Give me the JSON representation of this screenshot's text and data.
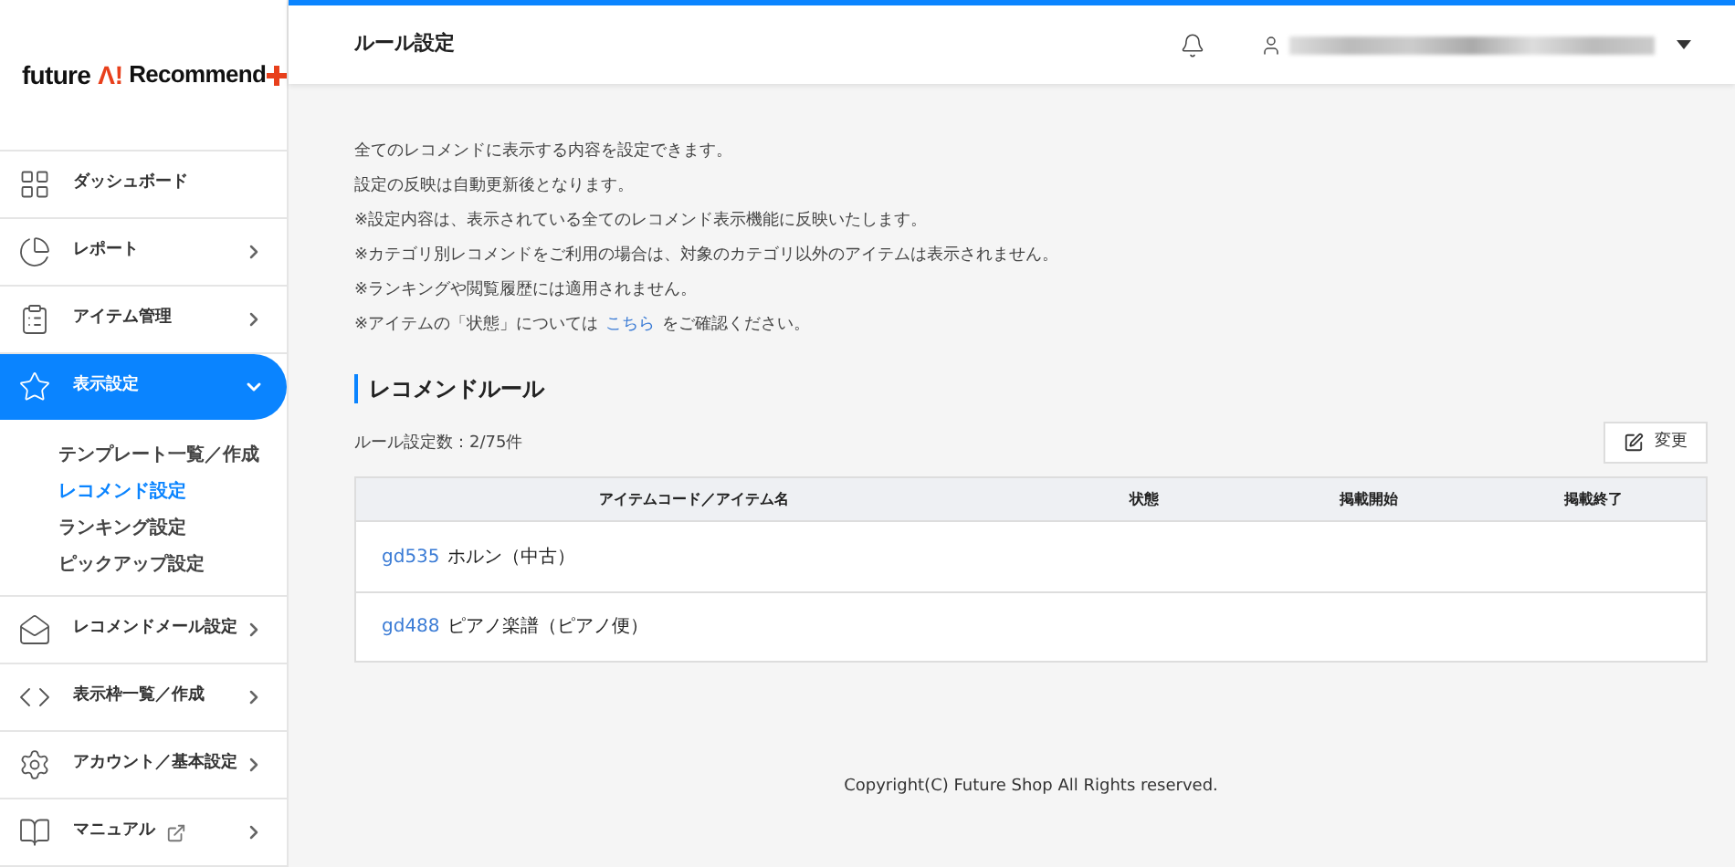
{
  "logo": {
    "part_1": "future",
    "part_2": "Λ!",
    "part_3": "Recommend"
  },
  "sidebar": {
    "items": [
      {
        "label": "ダッシュボード",
        "selected": false
      },
      {
        "label": "レポート",
        "selected": false,
        "expanded": false
      },
      {
        "label": "アイテム管理",
        "selected": false,
        "expanded": false
      },
      {
        "label": "表示設定",
        "selected": true,
        "expanded": true,
        "children": [
          {
            "label": "テンプレート一覧／作成",
            "selected": false
          },
          {
            "label": "レコメンド設定",
            "selected": true
          },
          {
            "label": "ランキング設定",
            "selected": false
          },
          {
            "label": "ピックアップ設定",
            "selected": false
          }
        ]
      },
      {
        "label": "レコメンドメール設定",
        "selected": false,
        "expanded": false
      },
      {
        "label": "表示枠一覧／作成",
        "selected": false,
        "expanded": false
      },
      {
        "label": "アカウント／基本設定",
        "selected": false,
        "expanded": false
      },
      {
        "label": "マニュアル",
        "selected": false,
        "expanded": false,
        "external": true
      }
    ]
  },
  "header": {
    "title": "ルール設定"
  },
  "notes": [
    "全てのレコメンドに表示する内容を設定できます。",
    "設定の反映は自動更新後となります。",
    "※設定内容は、表示されている全てのレコメンド表示機能に反映いたします。",
    "※カテゴリ別レコメンドをご利用の場合は、対象のカテゴリ以外のアイテムは表示されません。",
    "※ランキングや閲覧履歴には適用されません。"
  ],
  "status_note": {
    "before": "※アイテムの「状態」については",
    "link": "こちら",
    "after": "をご確認ください。"
  },
  "section": {
    "title": "レコメンドルール",
    "count": "ルール設定数：2/75件",
    "edit_button": "変更"
  },
  "table": {
    "columns": [
      "アイテムコード／アイテム名",
      "状態",
      "掲載開始",
      "掲載終了"
    ],
    "rows": [
      {
        "code": "gd535",
        "name": "ホルン（中古）"
      },
      {
        "code": "gd488",
        "name": "ピアノ楽譜（ピアノ便）"
      }
    ]
  },
  "footer": "Copyright(C) Future Shop All Rights reserved."
}
